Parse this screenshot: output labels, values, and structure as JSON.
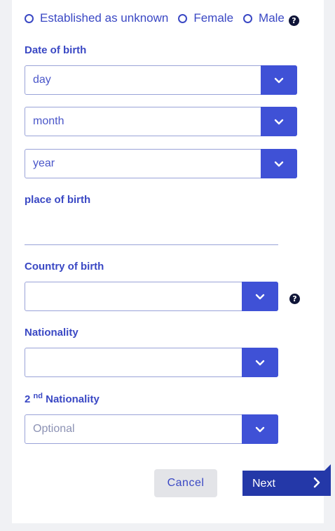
{
  "gender": {
    "options": [
      "Established as unknown",
      "Female",
      "Male"
    ],
    "help_icon": "question-circle-icon"
  },
  "date_of_birth": {
    "label": "Date of birth",
    "day_placeholder": "day",
    "month_placeholder": "month",
    "year_placeholder": "year"
  },
  "place_of_birth": {
    "label": "place of birth",
    "value": ""
  },
  "country_of_birth": {
    "label": "Country of birth",
    "value": "",
    "help_icon": "question-circle-icon"
  },
  "nationality": {
    "label": "Nationality",
    "value": ""
  },
  "second_nationality": {
    "label_prefix": "2",
    "label_sup": "nd",
    "label_suffix": " Nationality",
    "placeholder": "Optional"
  },
  "actions": {
    "cancel_label": "Cancel",
    "next_label": "Next"
  },
  "colors": {
    "accent": "#3f51d6",
    "text": "#3a48c4",
    "next_button": "#2438a8"
  }
}
